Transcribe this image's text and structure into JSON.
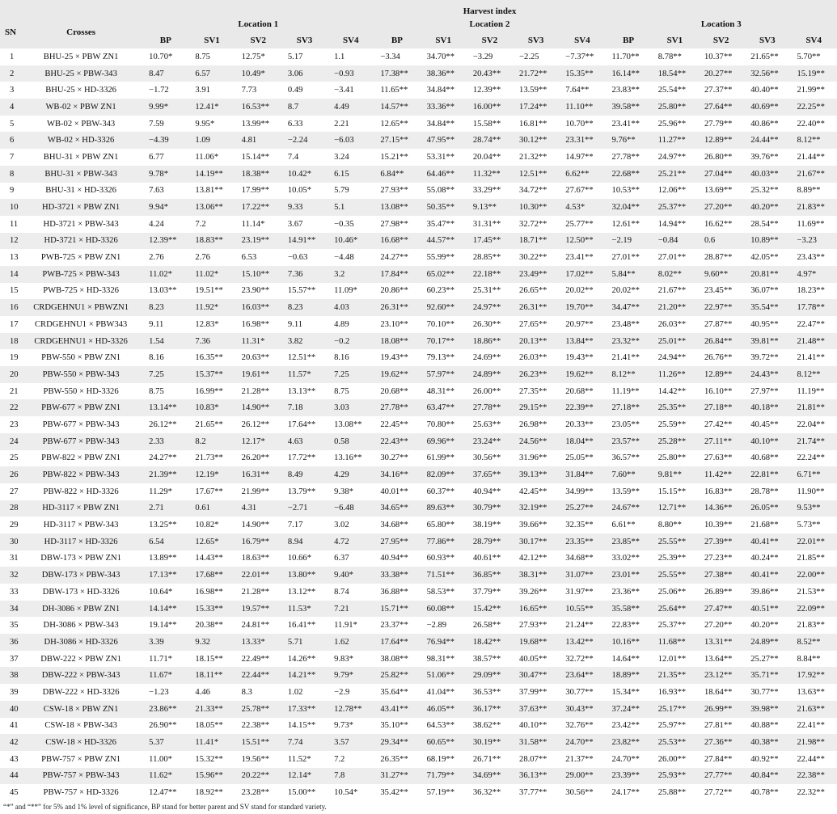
{
  "header": {
    "sn": "SN",
    "crosses": "Crosses",
    "group_title": "Harvest index",
    "locations": [
      "Location 1",
      "Location 2",
      "Location 3"
    ],
    "subcols": [
      "BP",
      "SV1",
      "SV2",
      "SV3",
      "SV4"
    ]
  },
  "rows": [
    [
      "1",
      "BHU-25 × PBW ZN1",
      "10.70*",
      "8.75",
      "12.75*",
      "5.17",
      "1.1",
      "−3.34",
      "34.70**",
      "−3.29",
      "−2.25",
      "−7.37**",
      "11.70**",
      "8.78**",
      "10.37**",
      "21.65**",
      "5.70**"
    ],
    [
      "2",
      "BHU-25 × PBW-343",
      "8.47",
      "6.57",
      "10.49*",
      "3.06",
      "−0.93",
      "17.38**",
      "38.36**",
      "20.43**",
      "21.72**",
      "15.35**",
      "16.14**",
      "18.54**",
      "20.27**",
      "32.56**",
      "15.19**"
    ],
    [
      "3",
      "BHU-25 × HD-3326",
      "−1.72",
      "3.91",
      "7.73",
      "0.49",
      "−3.41",
      "11.65**",
      "34.84**",
      "12.39**",
      "13.59**",
      "7.64**",
      "23.83**",
      "25.54**",
      "27.37**",
      "40.40**",
      "21.99**"
    ],
    [
      "4",
      "WB-02 × PBW ZN1",
      "9.99*",
      "12.41*",
      "16.53**",
      "8.7",
      "4.49",
      "14.57**",
      "33.36**",
      "16.00**",
      "17.24**",
      "11.10**",
      "39.58**",
      "25.80**",
      "27.64**",
      "40.69**",
      "22.25**"
    ],
    [
      "5",
      "WB-02 × PBW-343",
      "7.59",
      "9.95*",
      "13.99**",
      "6.33",
      "2.21",
      "12.65**",
      "34.84**",
      "15.58**",
      "16.81**",
      "10.70**",
      "23.41**",
      "25.96**",
      "27.79**",
      "40.86**",
      "22.40**"
    ],
    [
      "6",
      "WB-02 × HD-3326",
      "−4.39",
      "1.09",
      "4.81",
      "−2.24",
      "−6.03",
      "27.15**",
      "47.95**",
      "28.74**",
      "30.12**",
      "23.31**",
      "9.76**",
      "11.27**",
      "12.89**",
      "24.44**",
      "8.12**"
    ],
    [
      "7",
      "BHU-31 × PBW ZN1",
      "6.77",
      "11.06*",
      "15.14**",
      "7.4",
      "3.24",
      "15.21**",
      "53.31**",
      "20.04**",
      "21.32**",
      "14.97**",
      "27.78**",
      "24.97**",
      "26.80**",
      "39.76**",
      "21.44**"
    ],
    [
      "8",
      "BHU-31 × PBW-343",
      "9.78*",
      "14.19**",
      "18.38**",
      "10.42*",
      "6.15",
      "6.84**",
      "64.46**",
      "11.32**",
      "12.51**",
      "6.62**",
      "22.68**",
      "25.21**",
      "27.04**",
      "40.03**",
      "21.67**"
    ],
    [
      "9",
      "BHU-31 × HD-3326",
      "7.63",
      "13.81**",
      "17.99**",
      "10.05*",
      "5.79",
      "27.93**",
      "55.08**",
      "33.29**",
      "34.72**",
      "27.67**",
      "10.53**",
      "12.06**",
      "13.69**",
      "25.32**",
      "8.89**"
    ],
    [
      "10",
      "HD-3721 × PBW ZN1",
      "9.94*",
      "13.06**",
      "17.22**",
      "9.33",
      "5.1",
      "13.08**",
      "50.35**",
      "9.13**",
      "10.30**",
      "4.53*",
      "32.04**",
      "25.37**",
      "27.20**",
      "40.20**",
      "21.83**"
    ],
    [
      "11",
      "HD-3721 × PBW-343",
      "4.24",
      "7.2",
      "11.14*",
      "3.67",
      "−0.35",
      "27.98**",
      "35.47**",
      "31.31**",
      "32.72**",
      "25.77**",
      "12.61**",
      "14.94**",
      "16.62**",
      "28.54**",
      "11.69**"
    ],
    [
      "12",
      "HD-3721 × HD-3326",
      "12.39**",
      "18.83**",
      "23.19**",
      "14.91**",
      "10.46*",
      "16.68**",
      "44.57**",
      "17.45**",
      "18.71**",
      "12.50**",
      "−2.19",
      "−0.84",
      "0.6",
      "10.89**",
      "−3.23"
    ],
    [
      "13",
      "PWB-725 × PBW ZN1",
      "2.76",
      "2.76",
      "6.53",
      "−0.63",
      "−4.48",
      "24.27**",
      "55.99**",
      "28.85**",
      "30.22**",
      "23.41**",
      "27.01**",
      "27.01**",
      "28.87**",
      "42.05**",
      "23.43**"
    ],
    [
      "14",
      "PWB-725 × PBW-343",
      "11.02*",
      "11.02*",
      "15.10**",
      "7.36",
      "3.2",
      "17.84**",
      "65.02**",
      "22.18**",
      "23.49**",
      "17.02**",
      "5.84**",
      "8.02**",
      "9.60**",
      "20.81**",
      "4.97*"
    ],
    [
      "15",
      "PWB-725 × HD-3326",
      "13.03**",
      "19.51**",
      "23.90**",
      "15.57**",
      "11.09*",
      "20.86**",
      "60.23**",
      "25.31**",
      "26.65**",
      "20.02**",
      "20.02**",
      "21.67**",
      "23.45**",
      "36.07**",
      "18.23**"
    ],
    [
      "16",
      "CRDGEHNU1 × PBWZN1",
      "8.23",
      "11.92*",
      "16.03**",
      "8.23",
      "4.03",
      "26.31**",
      "92.60**",
      "24.97**",
      "26.31**",
      "19.70**",
      "34.47**",
      "21.20**",
      "22.97**",
      "35.54**",
      "17.78**"
    ],
    [
      "17",
      "CRDGEHNU1 × PBW343",
      "9.11",
      "12.83*",
      "16.98**",
      "9.11",
      "4.89",
      "23.10**",
      "70.10**",
      "26.30**",
      "27.65**",
      "20.97**",
      "23.48**",
      "26.03**",
      "27.87**",
      "40.95**",
      "22.47**"
    ],
    [
      "18",
      "CRDGEHNU1 × HD-3326",
      "1.54",
      "7.36",
      "11.31*",
      "3.82",
      "−0.2",
      "18.08**",
      "70.17**",
      "18.86**",
      "20.13**",
      "13.84**",
      "23.32**",
      "25.01**",
      "26.84**",
      "39.81**",
      "21.48**"
    ],
    [
      "19",
      "PBW-550 × PBW ZN1",
      "8.16",
      "16.35**",
      "20.63**",
      "12.51**",
      "8.16",
      "19.43**",
      "79.13**",
      "24.69**",
      "26.03**",
      "19.43**",
      "21.41**",
      "24.94**",
      "26.76**",
      "39.72**",
      "21.41**"
    ],
    [
      "20",
      "PBW-550 × PBW-343",
      "7.25",
      "15.37**",
      "19.61**",
      "11.57*",
      "7.25",
      "19.62**",
      "57.97**",
      "24.89**",
      "26.23**",
      "19.62**",
      "8.12**",
      "11.26**",
      "12.89**",
      "24.43**",
      "8.12**"
    ],
    [
      "21",
      "PBW-550 × HD-3326",
      "8.75",
      "16.99**",
      "21.28**",
      "13.13**",
      "8.75",
      "20.68**",
      "48.31**",
      "26.00**",
      "27.35**",
      "20.68**",
      "11.19**",
      "14.42**",
      "16.10**",
      "27.97**",
      "11.19**"
    ],
    [
      "22",
      "PBW-677 × PBW ZN1",
      "13.14**",
      "10.83*",
      "14.90**",
      "7.18",
      "3.03",
      "27.78**",
      "63.47**",
      "27.78**",
      "29.15**",
      "22.39**",
      "27.18**",
      "25.35**",
      "27.18**",
      "40.18**",
      "21.81**"
    ],
    [
      "23",
      "PBW-677 × PBW-343",
      "26.12**",
      "21.65**",
      "26.12**",
      "17.64**",
      "13.08**",
      "22.45**",
      "70.80**",
      "25.63**",
      "26.98**",
      "20.33**",
      "23.05**",
      "25.59**",
      "27.42**",
      "40.45**",
      "22.04**"
    ],
    [
      "24",
      "PBW-677 × PBW-343",
      "2.33",
      "8.2",
      "12.17*",
      "4.63",
      "0.58",
      "22.43**",
      "69.96**",
      "23.24**",
      "24.56**",
      "18.04**",
      "23.57**",
      "25.28**",
      "27.11**",
      "40.10**",
      "21.74**"
    ],
    [
      "25",
      "PBW-822 × PBW ZN1",
      "24.27**",
      "21.73**",
      "26.20**",
      "17.72**",
      "13.16**",
      "30.27**",
      "61.99**",
      "30.56**",
      "31.96**",
      "25.05**",
      "36.57**",
      "25.80**",
      "27.63**",
      "40.68**",
      "22.24**"
    ],
    [
      "26",
      "PBW-822 × PBW-343",
      "21.39**",
      "12.19*",
      "16.31**",
      "8.49",
      "4.29",
      "34.16**",
      "82.09**",
      "37.65**",
      "39.13**",
      "31.84**",
      "7.60**",
      "9.81**",
      "11.42**",
      "22.81**",
      "6.71**"
    ],
    [
      "27",
      "PBW-822 × HD-3326",
      "11.29*",
      "17.67**",
      "21.99**",
      "13.79**",
      "9.38*",
      "40.01**",
      "60.37**",
      "40.94**",
      "42.45**",
      "34.99**",
      "13.59**",
      "15.15**",
      "16.83**",
      "28.78**",
      "11.90**"
    ],
    [
      "28",
      "HD-3117 × PBW ZN1",
      "2.71",
      "0.61",
      "4.31",
      "−2.71",
      "−6.48",
      "34.65**",
      "89.63**",
      "30.79**",
      "32.19**",
      "25.27**",
      "24.67**",
      "12.71**",
      "14.36**",
      "26.05**",
      "9.53**"
    ],
    [
      "29",
      "HD-3117 × PBW-343",
      "13.25**",
      "10.82*",
      "14.90**",
      "7.17",
      "3.02",
      "34.68**",
      "65.80**",
      "38.19**",
      "39.66**",
      "32.35**",
      "6.61**",
      "8.80**",
      "10.39**",
      "21.68**",
      "5.73**"
    ],
    [
      "30",
      "HD-3117 × HD-3326",
      "6.54",
      "12.65*",
      "16.79**",
      "8.94",
      "4.72",
      "27.95**",
      "77.86**",
      "28.79**",
      "30.17**",
      "23.35**",
      "23.85**",
      "25.55**",
      "27.39**",
      "40.41**",
      "22.01**"
    ],
    [
      "31",
      "DBW-173 × PBW ZN1",
      "13.89**",
      "14.43**",
      "18.63**",
      "10.66*",
      "6.37",
      "40.94**",
      "60.93**",
      "40.61**",
      "42.12**",
      "34.68**",
      "33.02**",
      "25.39**",
      "27.23**",
      "40.24**",
      "21.85**"
    ],
    [
      "32",
      "DBW-173 × PBW-343",
      "17.13**",
      "17.68**",
      "22.01**",
      "13.80**",
      "9.40*",
      "33.38**",
      "71.51**",
      "36.85**",
      "38.31**",
      "31.07**",
      "23.01**",
      "25.55**",
      "27.38**",
      "40.41**",
      "22.00**"
    ],
    [
      "33",
      "DBW-173 × HD-3326",
      "10.64*",
      "16.98**",
      "21.28**",
      "13.12**",
      "8.74",
      "36.88**",
      "58.53**",
      "37.79**",
      "39.26**",
      "31.97**",
      "23.36**",
      "25.06**",
      "26.89**",
      "39.86**",
      "21.53**"
    ],
    [
      "34",
      "DH-3086 × PBW ZN1",
      "14.14**",
      "15.33**",
      "19.57**",
      "11.53*",
      "7.21",
      "15.71**",
      "60.08**",
      "15.42**",
      "16.65**",
      "10.55**",
      "35.58**",
      "25.64**",
      "27.47**",
      "40.51**",
      "22.09**"
    ],
    [
      "35",
      "DH-3086 × PBW-343",
      "19.14**",
      "20.38**",
      "24.81**",
      "16.41**",
      "11.91*",
      "23.37**",
      "−2.89",
      "26.58**",
      "27.93**",
      "21.24**",
      "22.83**",
      "25.37**",
      "27.20**",
      "40.20**",
      "21.83**"
    ],
    [
      "36",
      "DH-3086 × HD-3326",
      "3.39",
      "9.32",
      "13.33*",
      "5.71",
      "1.62",
      "17.64**",
      "76.94**",
      "18.42**",
      "19.68**",
      "13.42**",
      "10.16**",
      "11.68**",
      "13.31**",
      "24.89**",
      "8.52**"
    ],
    [
      "37",
      "DBW-222 × PBW ZN1",
      "11.71*",
      "18.15**",
      "22.49**",
      "14.26**",
      "9.83*",
      "38.08**",
      "98.31**",
      "38.57**",
      "40.05**",
      "32.72**",
      "14.64**",
      "12.01**",
      "13.64**",
      "25.27**",
      "8.84**"
    ],
    [
      "38",
      "DBW-222 × PBW-343",
      "11.67*",
      "18.11**",
      "22.44**",
      "14.21**",
      "9.79*",
      "25.82**",
      "51.06**",
      "29.09**",
      "30.47**",
      "23.64**",
      "18.89**",
      "21.35**",
      "23.12**",
      "35.71**",
      "17.92**"
    ],
    [
      "39",
      "DBW-222 × HD-3326",
      "−1.23",
      "4.46",
      "8.3",
      "1.02",
      "−2.9",
      "35.64**",
      "41.04**",
      "36.53**",
      "37.99**",
      "30.77**",
      "15.34**",
      "16.93**",
      "18.64**",
      "30.77**",
      "13.63**"
    ],
    [
      "40",
      "CSW-18 × PBW ZN1",
      "23.86**",
      "21.33**",
      "25.78**",
      "17.33**",
      "12.78**",
      "43.41**",
      "46.05**",
      "36.17**",
      "37.63**",
      "30.43**",
      "37.24**",
      "25.17**",
      "26.99**",
      "39.98**",
      "21.63**"
    ],
    [
      "41",
      "CSW-18 × PBW-343",
      "26.90**",
      "18.05**",
      "22.38**",
      "14.15**",
      "9.73*",
      "35.10**",
      "64.53**",
      "38.62**",
      "40.10**",
      "32.76**",
      "23.42**",
      "25.97**",
      "27.81**",
      "40.88**",
      "22.41**"
    ],
    [
      "42",
      "CSW-18 × HD-3326",
      "5.37",
      "11.41*",
      "15.51**",
      "7.74",
      "3.57",
      "29.34**",
      "60.65**",
      "30.19**",
      "31.58**",
      "24.70**",
      "23.82**",
      "25.53**",
      "27.36**",
      "40.38**",
      "21.98**"
    ],
    [
      "43",
      "PBW-757 × PBW ZN1",
      "11.00*",
      "15.32**",
      "19.56**",
      "11.52*",
      "7.2",
      "26.35**",
      "68.19**",
      "26.71**",
      "28.07**",
      "21.37**",
      "24.70**",
      "26.00**",
      "27.84**",
      "40.92**",
      "22.44**"
    ],
    [
      "44",
      "PBW-757 × PBW-343",
      "11.62*",
      "15.96**",
      "20.22**",
      "12.14*",
      "7.8",
      "31.27**",
      "71.79**",
      "34.69**",
      "36.13**",
      "29.00**",
      "23.39**",
      "25.93**",
      "27.77**",
      "40.84**",
      "22.38**"
    ],
    [
      "45",
      "PBW-757 × HD-3326",
      "12.47**",
      "18.92**",
      "23.28**",
      "15.00**",
      "10.54*",
      "35.42**",
      "57.19**",
      "36.32**",
      "37.77**",
      "30.56**",
      "24.17**",
      "25.88**",
      "27.72**",
      "40.78**",
      "22.32**"
    ]
  ],
  "footnote": "“*” and “**” for 5% and 1% level of significance, BP stand for better parent and SV stand for standard variety."
}
